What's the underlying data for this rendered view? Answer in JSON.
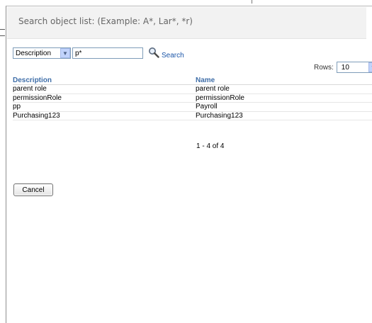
{
  "header": {
    "title": "Search object list: (Example: A*, Lar*, *r)"
  },
  "search": {
    "field_selected": "Description",
    "query_value": "p*",
    "search_label": "Search"
  },
  "rows": {
    "label": "Rows:",
    "selected": "10"
  },
  "table": {
    "columns": [
      "Description",
      "Name"
    ],
    "rows": [
      [
        "parent role",
        "parent role"
      ],
      [
        "permissionRole",
        "permissionRole"
      ],
      [
        "pp",
        "Payroll"
      ],
      [
        "Purchasing123",
        "Purchasing123"
      ]
    ]
  },
  "pager": {
    "text": "1 - 4 of 4"
  },
  "actions": {
    "cancel_label": "Cancel"
  },
  "colors": {
    "link": "#1a55a8",
    "column_header": "#3f6ea8",
    "header_bar": "#f2f2f2"
  }
}
